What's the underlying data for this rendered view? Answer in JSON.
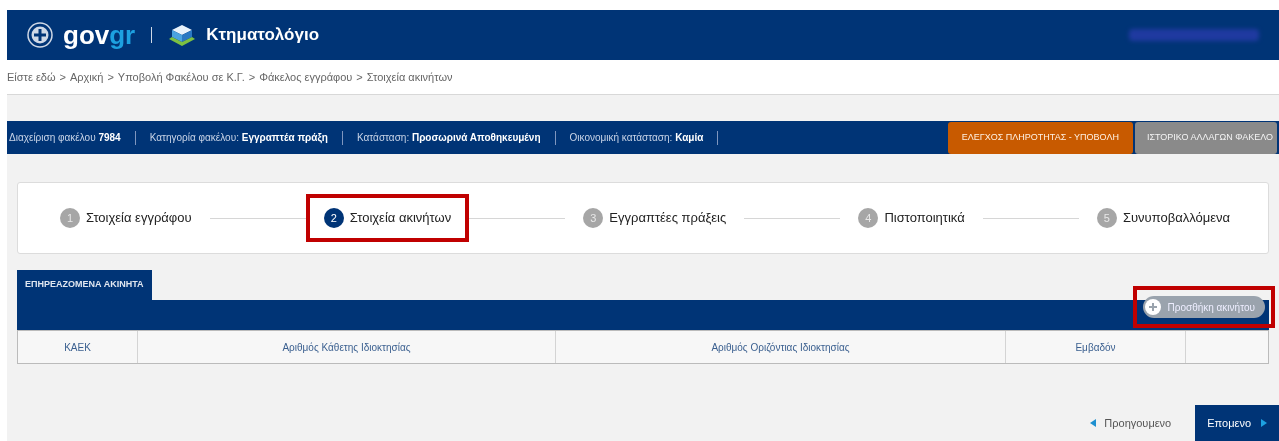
{
  "header": {
    "logo_text_1": "gov",
    "logo_text_2": "gr",
    "app_name": "Κτηματολόγιο"
  },
  "breadcrumb": [
    "Είστε εδώ",
    "Αρχική",
    "Υποβολή Φακέλου σε Κ.Γ.",
    "Φάκελος εγγράφου",
    "Στοιχεία ακινήτων"
  ],
  "breadcrumb_separator": ">",
  "info_bar": {
    "items": [
      {
        "label": "Διαχείριση φακέλου",
        "value": "7984"
      },
      {
        "label": "Κατηγορία φακέλου:",
        "value": "Εγγραπτέα πράξη"
      },
      {
        "label": "Κατάσταση:",
        "value": "Προσωρινά Αποθηκευμένη"
      },
      {
        "label": "Οικονομική κατάσταση:",
        "value": "Καμία"
      }
    ],
    "buttons": [
      {
        "label": "ΕΛΕΓΧΟΣ ΠΛΗΡΟΤΗΤΑΣ - ΥΠΟΒΟΛΗ",
        "kind": "primary"
      },
      {
        "label": "ΙΣΤΟΡΙΚΟ ΑΛΛΑΓΩΝ ΦΑΚΕΛΟ",
        "kind": "secondary"
      }
    ]
  },
  "steps": [
    {
      "number": "1",
      "label": "Στοιχεία εγγράφου",
      "selected": false,
      "highlighted": false
    },
    {
      "number": "2",
      "label": "Στοιχεία ακινήτων",
      "selected": true,
      "highlighted": true
    },
    {
      "number": "3",
      "label": "Εγγραπτέες πράξεις",
      "selected": false,
      "highlighted": false
    },
    {
      "number": "4",
      "label": "Πιστοποιητικά",
      "selected": false,
      "highlighted": false
    },
    {
      "number": "5",
      "label": "Συνυποβαλλόμενα",
      "selected": false,
      "highlighted": false
    }
  ],
  "tabs": [
    {
      "label": "ΕΠΗΡΕΑΖΟΜΕΝΑ ΑΚΙΝΗΤΑ",
      "selected": true
    }
  ],
  "add_button": {
    "label": "Προσθήκη ακινήτου",
    "highlighted": true
  },
  "table": {
    "columns": [
      "ΚΑΕΚ",
      "Αριθμός Κάθετης Ιδιοκτησίας",
      "Αριθμός Οριζόντιας Ιδιοκτησίας",
      "Εμβαδόν"
    ]
  },
  "pager": {
    "previous": "Προηγουμενο",
    "next": "Επομενο"
  }
}
